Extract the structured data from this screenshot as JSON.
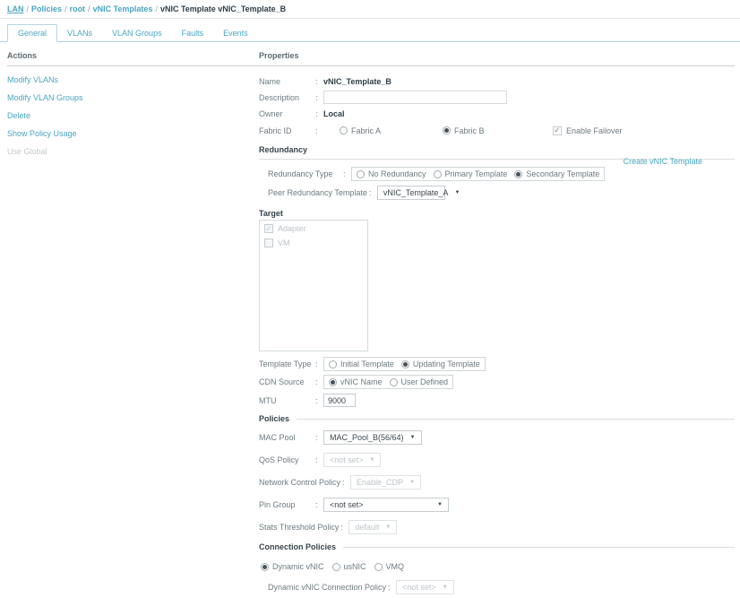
{
  "breadcrumb": {
    "items": [
      "LAN",
      "Policies",
      "root",
      "vNIC Templates"
    ],
    "current": "vNIC Template vNIC_Template_B"
  },
  "tabs": [
    {
      "label": "General",
      "active": true
    },
    {
      "label": "VLANs",
      "active": false
    },
    {
      "label": "VLAN Groups",
      "active": false
    },
    {
      "label": "Faults",
      "active": false
    },
    {
      "label": "Events",
      "active": false
    }
  ],
  "actions": {
    "title": "Actions",
    "items": [
      {
        "label": "Modify VLANs",
        "enabled": true
      },
      {
        "label": "Modify VLAN Groups",
        "enabled": true
      },
      {
        "label": "Delete",
        "enabled": true
      },
      {
        "label": "Show Policy Usage",
        "enabled": true
      },
      {
        "label": "Use Global",
        "enabled": false
      }
    ]
  },
  "properties": {
    "title": "Properties",
    "name_label": "Name",
    "name_value": "vNIC_Template_B",
    "description_label": "Description",
    "description_value": "",
    "owner_label": "Owner",
    "owner_value": "Local",
    "fabric_label": "Fabric ID",
    "fabric_options": [
      {
        "label": "Fabric A",
        "selected": false
      },
      {
        "label": "Fabric B",
        "selected": true
      }
    ],
    "failover_label": "Enable Failover",
    "failover_checked": true
  },
  "redundancy": {
    "title": "Redundancy",
    "type_label": "Redundancy Type",
    "type_options": [
      {
        "label": "No Redundancy",
        "selected": false
      },
      {
        "label": "Primary Template",
        "selected": false
      },
      {
        "label": "Secondary Template",
        "selected": true
      }
    ],
    "peer_label": "Peer Redundancy Template",
    "peer_value": "vNIC_Template_A",
    "create_link": "Create vNIC Template"
  },
  "target": {
    "title": "Target",
    "items": [
      {
        "label": "Adapter",
        "checked": true
      },
      {
        "label": "VM",
        "checked": false
      }
    ]
  },
  "template": {
    "type_label": "Template Type",
    "type_options": [
      {
        "label": "Initial Template",
        "selected": false
      },
      {
        "label": "Updating Template",
        "selected": true
      }
    ],
    "cdn_label": "CDN Source",
    "cdn_options": [
      {
        "label": "vNIC Name",
        "selected": true
      },
      {
        "label": "User Defined",
        "selected": false
      }
    ],
    "mtu_label": "MTU",
    "mtu_value": "9000"
  },
  "policies": {
    "title": "Policies",
    "rows": [
      {
        "label": "MAC Pool",
        "value": "MAC_Pool_B(56/64)",
        "disabled": false
      },
      {
        "label": "QoS Policy",
        "value": "<not set>",
        "disabled": true
      },
      {
        "label": "Network Control Policy",
        "value": "Enable_CDP",
        "disabled": true
      },
      {
        "label": "Pin Group",
        "value": "<not set>",
        "disabled": false
      },
      {
        "label": "Stats Threshold Policy",
        "value": "default",
        "disabled": true
      }
    ]
  },
  "connection": {
    "title": "Connection Policies",
    "options": [
      {
        "label": "Dynamic vNIC",
        "selected": true
      },
      {
        "label": "usNIC",
        "selected": false
      },
      {
        "label": "VMQ",
        "selected": false
      }
    ],
    "policy_label": "Dynamic vNIC Connection Policy",
    "policy_value": "<not set>"
  }
}
